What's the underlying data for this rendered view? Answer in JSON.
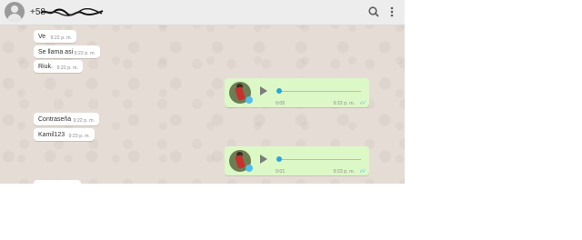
{
  "header": {
    "contact_name": "+58",
    "icons": [
      "avatar-icon",
      "search-icon",
      "menu-icon"
    ]
  },
  "messages": [
    {
      "type": "in",
      "text": "Ve",
      "time": "9:22 p. m."
    },
    {
      "type": "in",
      "text": "Se llama asi",
      "time": "9:22 p. m."
    },
    {
      "type": "in",
      "text": "Riuk.",
      "time": "9:22 p. m."
    },
    {
      "type": "audio-out",
      "duration": "0:05",
      "time": "9:22 p. m."
    },
    {
      "type": "in",
      "text": "Contraseña",
      "time": "9:22 p. m."
    },
    {
      "type": "in",
      "text": "Kamil123",
      "time": "9:23 p. m."
    },
    {
      "type": "audio-out",
      "duration": "0:01",
      "time": "9:23 p. m."
    }
  ],
  "colors": {
    "chat_background": "#e5ddd5",
    "header_background": "#ededed",
    "outgoing_bubble": "#dcf8c6",
    "incoming_bubble": "#ffffff",
    "read_ticks": "#4fc3f7"
  }
}
